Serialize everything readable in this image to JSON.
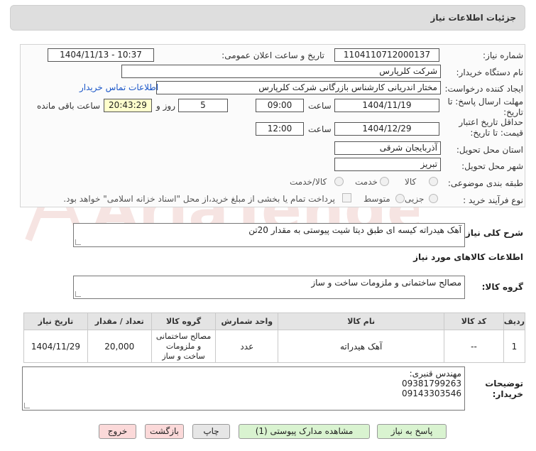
{
  "header": {
    "title": "جزئیات اطلاعات نیاز"
  },
  "watermark": {
    "text": "AriaTender.neT"
  },
  "form": {
    "need_number_label": "شماره نیاز:",
    "need_number": "1104110712000137",
    "announce_label": "تاریخ و ساعت اعلان عمومی:",
    "announce_value": "1404/11/13 - 10:37",
    "buyer_org_label": "نام دستگاه خریدار:",
    "buyer_org": "شرکت کلرپارس",
    "creator_label": "ایجاد کننده درخواست:",
    "creator": "مختار اندریانی کارشناس بازرگانی شرکت کلرپارس",
    "contact_link": "اطلاعات تماس خریدار",
    "deadline_label_1": "مهلت ارسال پاسخ: تا",
    "deadline_label_2": "تاریخ:",
    "deadline_date": "1404/11/19",
    "time_label": "ساعت",
    "deadline_time": "09:00",
    "days_value": "5",
    "days_label": "روز و",
    "remaining_time": "20:43:29",
    "remaining_label": "ساعت باقی مانده",
    "validity_label_1": "حداقل تاریخ اعتبار",
    "validity_label_2": "قیمت: تا تاریخ:",
    "validity_date": "1404/12/29",
    "validity_time": "12:00",
    "province_label": "استان محل تحویل:",
    "province": "آذربایجان شرقی",
    "city_label": "شهر محل تحویل:",
    "city": "تبریز",
    "category_label": "طبقه بندی موضوعی:",
    "category_options": [
      "کالا",
      "خدمت",
      "کالا/خدمت"
    ],
    "process_label": "نوع فرآیند خرید :",
    "process_options": [
      "جزیی",
      "متوسط"
    ],
    "payment_note": "پرداخت تمام یا بخشی از مبلغ خرید،از محل \"اسناد خزانه اسلامی\" خواهد بود."
  },
  "description": {
    "label": "شرح کلی نیاز:",
    "text": "آهک هیدراته کیسه ای طبق دیتا شیت پیوستی به مقدار 20تن"
  },
  "goods_info": {
    "title": "اطلاعات کالاهای مورد نیاز"
  },
  "goods_group": {
    "label": "گروه کالا:",
    "value": "مصالح ساختمانی و ملزومات ساخت و ساز"
  },
  "table": {
    "headers": [
      "ردیف",
      "کد کالا",
      "نام کالا",
      "واحد شمارش",
      "گروه کالا",
      "تعداد / مقدار",
      "تاریخ نیاز"
    ],
    "rows": [
      {
        "row": "1",
        "code": "--",
        "name": "آهک هیدراته",
        "unit": "عدد",
        "group": "مصالح ساختمانی و ملزومات ساخت و ساز",
        "qty": "20,000",
        "date": "1404/11/29"
      }
    ]
  },
  "buyer_notes": {
    "label_1": "توضیحات",
    "label_2": "خریدار:",
    "lines": [
      "مهندس قنبری:",
      "09381799263",
      "09143303546"
    ]
  },
  "buttons": {
    "reply": "پاسخ به نیاز",
    "view_docs": "مشاهده مدارک پیوستی (1)",
    "print": "چاپ",
    "back": "بازگشت",
    "exit": "خروج"
  },
  "colors": {
    "header_bg": "#dedede",
    "link": "#1a56c8",
    "remaining_bg": "#ffffcc",
    "green_btn": "#d9f3d0",
    "pink_btn": "#fbd9d9"
  }
}
